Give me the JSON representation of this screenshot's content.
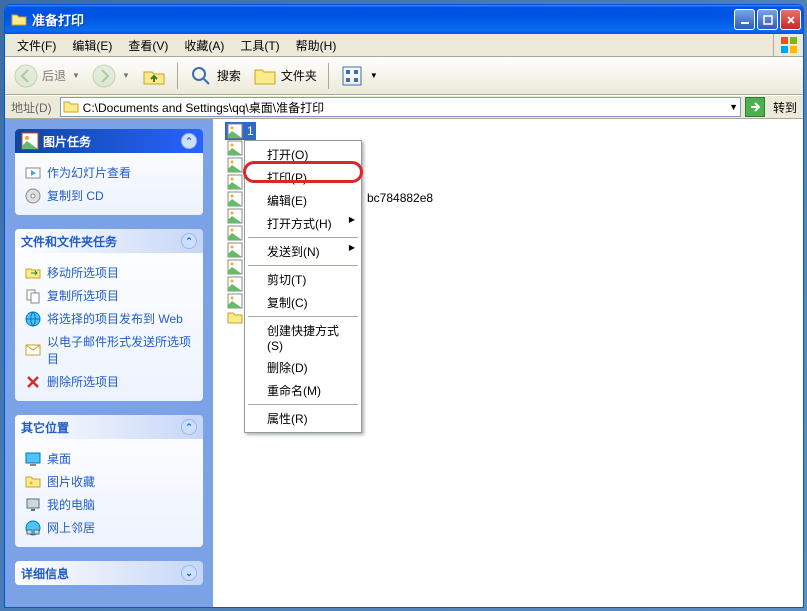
{
  "window": {
    "title": "准备打印"
  },
  "menubar": {
    "file": "文件(F)",
    "edit": "编辑(E)",
    "view": "查看(V)",
    "favorites": "收藏(A)",
    "tools": "工具(T)",
    "help": "帮助(H)"
  },
  "toolbar": {
    "back": "后退",
    "search": "搜索",
    "folders": "文件夹"
  },
  "addressbar": {
    "label": "地址(D)",
    "path": "C:\\Documents and Settings\\qq\\桌面\\准备打印",
    "go": "转到"
  },
  "sidebar": {
    "picture_tasks": {
      "title": "图片任务",
      "slideshow": "作为幻灯片查看",
      "copy_cd": "复制到 CD"
    },
    "folder_tasks": {
      "title": "文件和文件夹任务",
      "move": "移动所选项目",
      "copy": "复制所选项目",
      "publish": "将选择的项目发布到 Web",
      "email": "以电子邮件形式发送所选项目",
      "delete": "删除所选项目"
    },
    "other_places": {
      "title": "其它位置",
      "desktop": "桌面",
      "pictures": "图片收藏",
      "computer": "我的电脑",
      "network": "网上邻居"
    },
    "details": {
      "title": "详细信息"
    }
  },
  "files": {
    "selected": "1",
    "visible_fragment": "bc784882e8"
  },
  "context_menu": {
    "open": "打开(O)",
    "print": "打印(P)",
    "edit": "编辑(E)",
    "open_with": "打开方式(H)",
    "send_to": "发送到(N)",
    "cut": "剪切(T)",
    "copy": "复制(C)",
    "create_shortcut": "创建快捷方式(S)",
    "delete": "删除(D)",
    "rename": "重命名(M)",
    "properties": "属性(R)"
  }
}
